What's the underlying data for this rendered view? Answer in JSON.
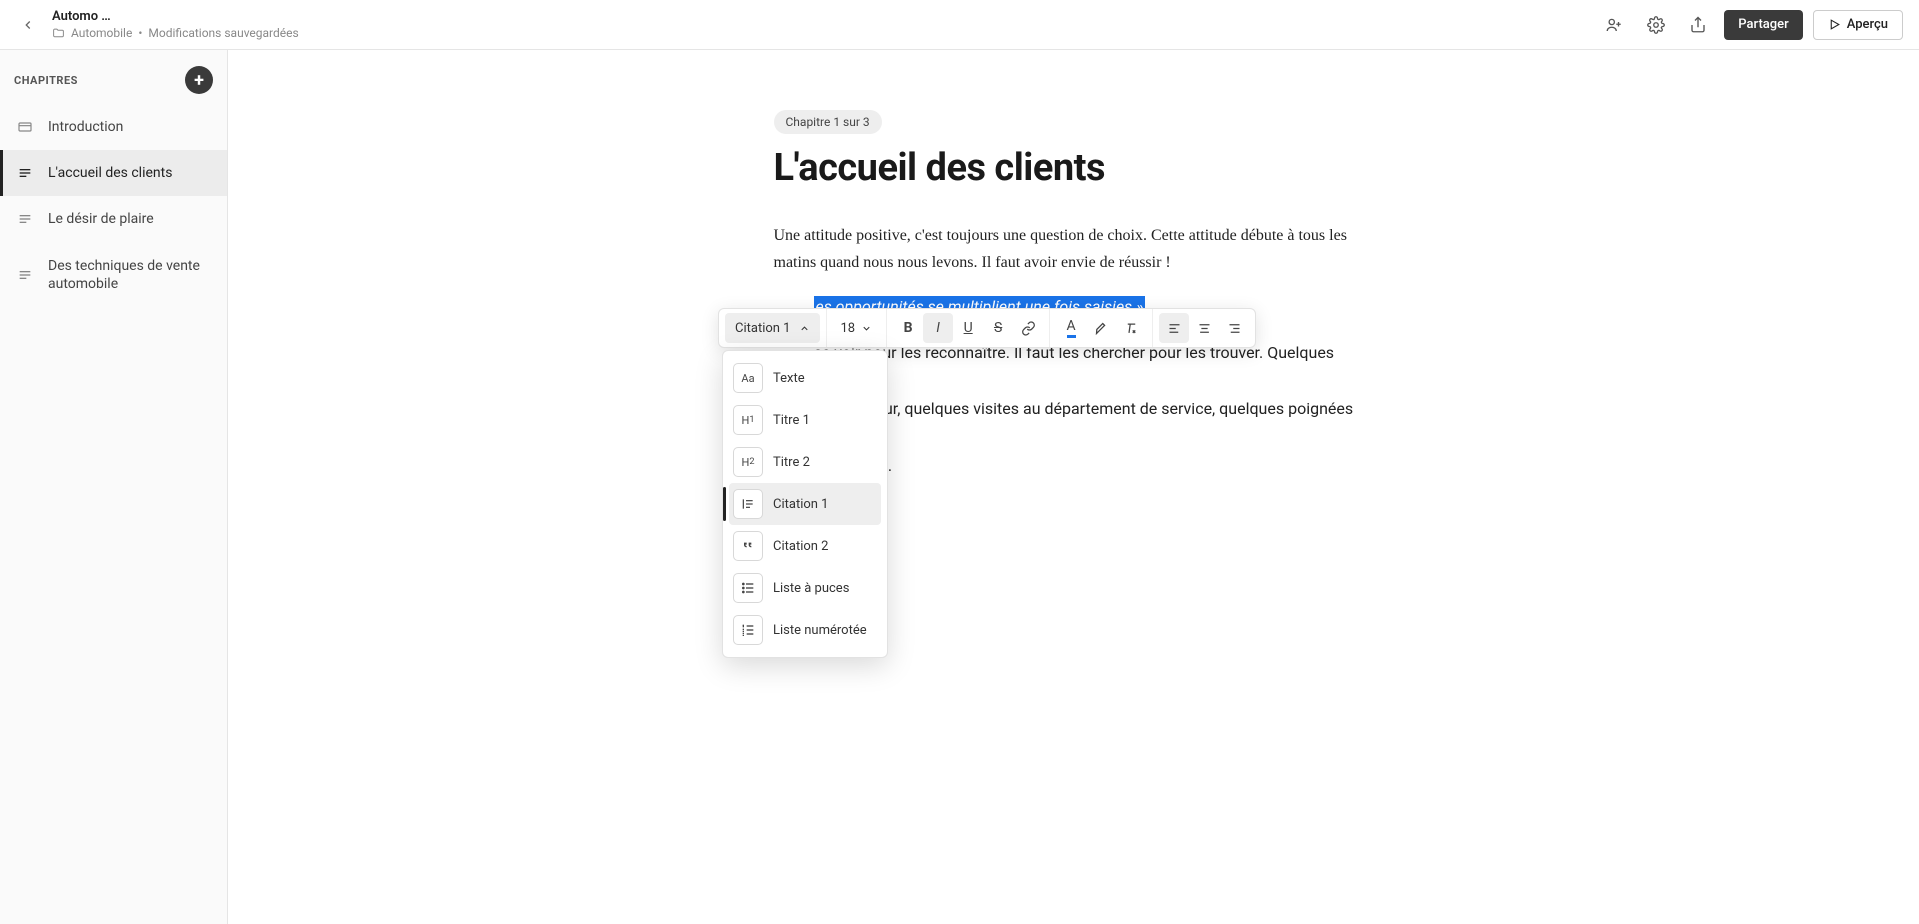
{
  "header": {
    "docTitle": "Automo …",
    "breadcrumb": "Automobile",
    "saveStatus": "Modifications sauvegardées",
    "shareLabel": "Partager",
    "previewLabel": "Aperçu"
  },
  "sidebar": {
    "title": "CHAPITRES",
    "items": [
      {
        "label": "Introduction"
      },
      {
        "label": "L'accueil des clients"
      },
      {
        "label": "Le désir de plaire"
      },
      {
        "label": "Des techniques de vente automobile"
      }
    ],
    "activeIndex": 1
  },
  "content": {
    "chapterBadge": "Chapitre 1 sur 3",
    "title": "L'accueil des clients",
    "paragraph1": "Une attitude positive, c'est toujours une question de choix. Cette attitude débute à tous les matins quand nous nous levons. Il faut avoir envie de réussir !",
    "quoteSelected": "es opportunités se multiplient une fois saisies »",
    "paragraph2Line1": "es voir pour les reconnaître. Il faut les chercher pour les trouver. Quelques coups de",
    "paragraph2Line2": "one par jour, quelques visites au département de service, quelques poignées de main",
    "paragraph2Line3": "ur est joué."
  },
  "toolbar": {
    "styleLabel": "Citation 1",
    "fontSize": "18"
  },
  "styleMenu": {
    "options": [
      {
        "label": "Texte",
        "icon": "Aa"
      },
      {
        "label": "Titre 1",
        "icon": "H1"
      },
      {
        "label": "Titre 2",
        "icon": "H2"
      },
      {
        "label": "Citation 1",
        "icon": "quote1"
      },
      {
        "label": "Citation 2",
        "icon": "quote2"
      },
      {
        "label": "Liste à puces",
        "icon": "bullets"
      },
      {
        "label": "Liste numérotée",
        "icon": "numbers"
      }
    ],
    "activeIndex": 3
  }
}
